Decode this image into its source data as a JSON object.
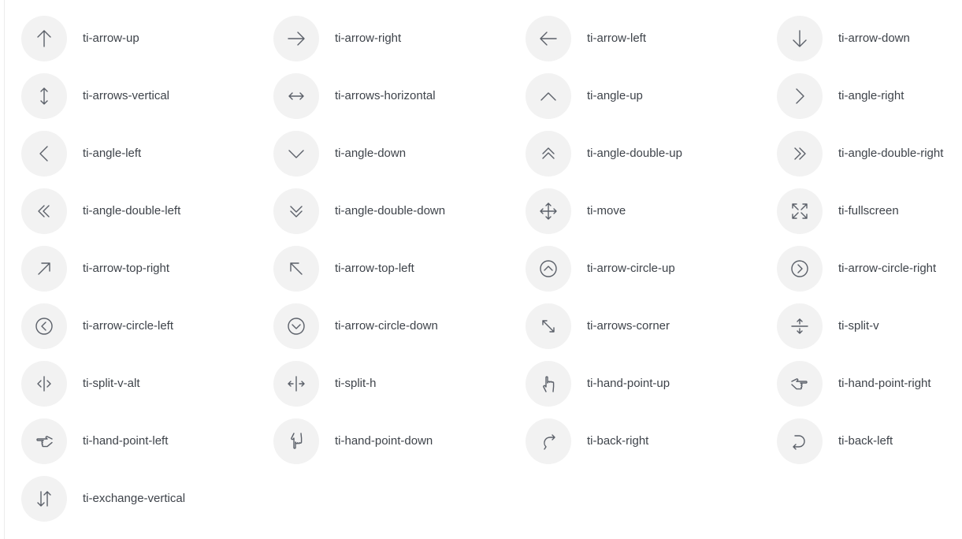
{
  "icons": [
    {
      "label": "ti-arrow-up",
      "icon": "arrow-up-icon"
    },
    {
      "label": "ti-arrow-right",
      "icon": "arrow-right-icon"
    },
    {
      "label": "ti-arrow-left",
      "icon": "arrow-left-icon"
    },
    {
      "label": "ti-arrow-down",
      "icon": "arrow-down-icon"
    },
    {
      "label": "ti-arrows-vertical",
      "icon": "arrows-vertical-icon"
    },
    {
      "label": "ti-arrows-horizontal",
      "icon": "arrows-horizontal-icon"
    },
    {
      "label": "ti-angle-up",
      "icon": "angle-up-icon"
    },
    {
      "label": "ti-angle-right",
      "icon": "angle-right-icon"
    },
    {
      "label": "ti-angle-left",
      "icon": "angle-left-icon"
    },
    {
      "label": "ti-angle-down",
      "icon": "angle-down-icon"
    },
    {
      "label": "ti-angle-double-up",
      "icon": "angle-double-up-icon"
    },
    {
      "label": "ti-angle-double-right",
      "icon": "angle-double-right-icon"
    },
    {
      "label": "ti-angle-double-left",
      "icon": "angle-double-left-icon"
    },
    {
      "label": "ti-angle-double-down",
      "icon": "angle-double-down-icon"
    },
    {
      "label": "ti-move",
      "icon": "move-icon"
    },
    {
      "label": "ti-fullscreen",
      "icon": "fullscreen-icon"
    },
    {
      "label": "ti-arrow-top-right",
      "icon": "arrow-top-right-icon"
    },
    {
      "label": "ti-arrow-top-left",
      "icon": "arrow-top-left-icon"
    },
    {
      "label": "ti-arrow-circle-up",
      "icon": "arrow-circle-up-icon"
    },
    {
      "label": "ti-arrow-circle-right",
      "icon": "arrow-circle-right-icon"
    },
    {
      "label": "ti-arrow-circle-left",
      "icon": "arrow-circle-left-icon"
    },
    {
      "label": "ti-arrow-circle-down",
      "icon": "arrow-circle-down-icon"
    },
    {
      "label": "ti-arrows-corner",
      "icon": "arrows-corner-icon"
    },
    {
      "label": "ti-split-v",
      "icon": "split-v-icon"
    },
    {
      "label": "ti-split-v-alt",
      "icon": "split-v-alt-icon"
    },
    {
      "label": "ti-split-h",
      "icon": "split-h-icon"
    },
    {
      "label": "ti-hand-point-up",
      "icon": "hand-point-up-icon"
    },
    {
      "label": "ti-hand-point-right",
      "icon": "hand-point-right-icon"
    },
    {
      "label": "ti-hand-point-left",
      "icon": "hand-point-left-icon"
    },
    {
      "label": "ti-hand-point-down",
      "icon": "hand-point-down-icon"
    },
    {
      "label": "ti-back-right",
      "icon": "back-right-icon"
    },
    {
      "label": "ti-back-left",
      "icon": "back-left-icon"
    },
    {
      "label": "ti-exchange-vertical",
      "icon": "exchange-vertical-icon"
    }
  ],
  "colors": {
    "icon_stroke": "#5b6069",
    "circle_bg": "#f2f2f2",
    "label_text": "#3e434a"
  }
}
